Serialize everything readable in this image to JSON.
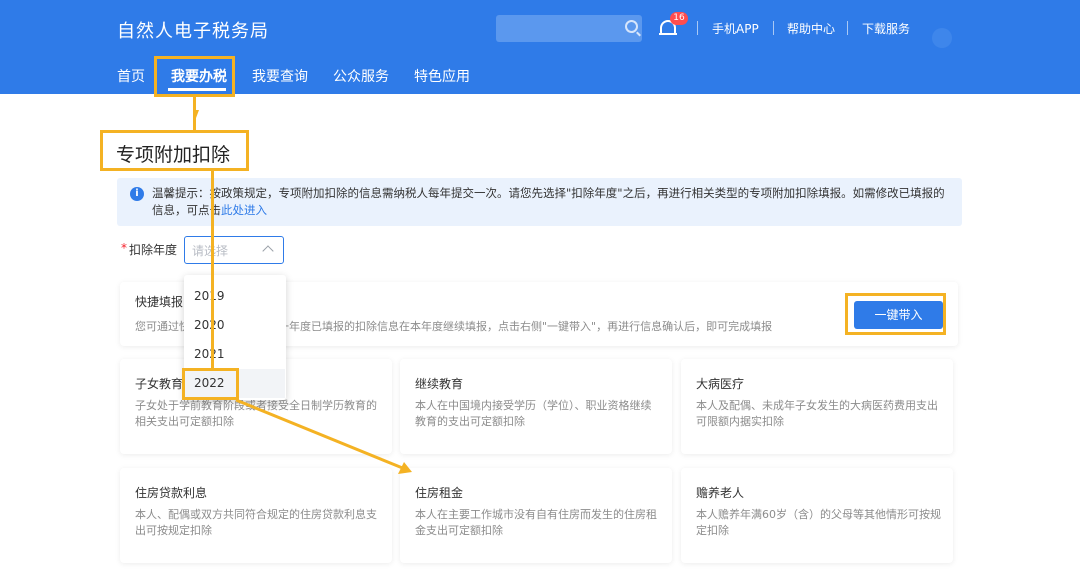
{
  "header": {
    "brand": "自然人电子税务局",
    "notification_count": "16",
    "links": [
      "手机APP",
      "帮助中心",
      "下载服务"
    ]
  },
  "nav": {
    "items": [
      "首页",
      "我要办税",
      "我要查询",
      "公众服务",
      "特色应用"
    ],
    "active": "我要办税"
  },
  "page": {
    "title": "专项附加扣除",
    "tip_text": "温馨提示：按政策规定，专项附加扣除的信息需纳税人每年提交一次。请您先选择\"扣除年度\"之后，再进行相关类型的专项附加扣除填报。如需修改已填报的信息，可点击",
    "tip_link": "此处进入"
  },
  "form": {
    "year_label": "扣除年度",
    "year_placeholder": "请选择",
    "year_options": [
      "2019",
      "2020",
      "2021",
      "2022"
    ],
    "highlighted_option": "2022"
  },
  "quick_fill": {
    "title": "快捷填报",
    "desc": "您可通过快捷填报功能，将上一年度已填报的扣除信息在本年度继续填报，点击右侧\"一键带入\"，再进行信息确认后，即可完成填报",
    "button": "一键带入"
  },
  "cards": [
    {
      "title": "子女教育",
      "desc": "子女处于学前教育阶段或者接受全日制学历教育的相关支出可定额扣除"
    },
    {
      "title": "继续教育",
      "desc": "本人在中国境内接受学历（学位）、职业资格继续教育的支出可定额扣除"
    },
    {
      "title": "大病医疗",
      "desc": "本人及配偶、未成年子女发生的大病医药费用支出可限额内据实扣除"
    },
    {
      "title": "住房贷款利息",
      "desc": "本人、配偶或双方共同符合规定的住房贷款利息支出可按规定扣除"
    },
    {
      "title": "住房租金",
      "desc": "本人在主要工作城市没有自有住房而发生的住房租金支出可定额扣除"
    },
    {
      "title": "赡养老人",
      "desc": "本人赡养年满60岁（含）的父母等其他情形可按规定扣除"
    }
  ],
  "colors": {
    "primary": "#2f7be8",
    "annotation": "#f4b223",
    "badge": "#ff4d4f"
  }
}
